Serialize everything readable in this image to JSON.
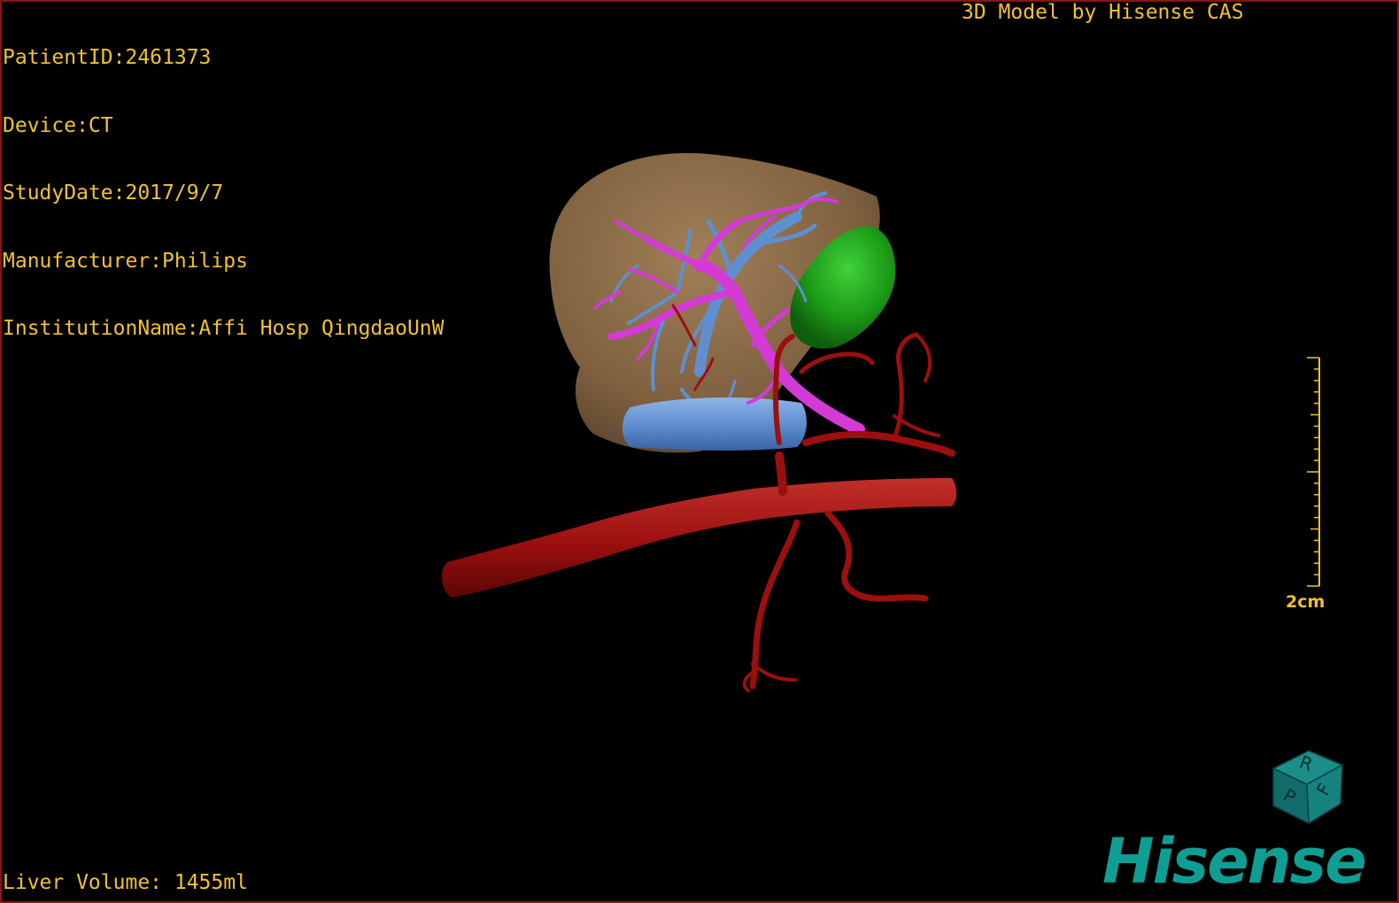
{
  "patient_info": {
    "patient_id": "PatientID:2461373",
    "device": "Device:CT",
    "study_date": "StudyDate:2017/9/7",
    "manufacturer": "Manufacturer:Philips",
    "institution": "InstitutionName:Affi Hosp QingdaoUnW"
  },
  "credit": "3D Model by Hisense CAS",
  "liver_volume": "Liver Volume: 1455ml",
  "scale_bar": {
    "label": "2cm"
  },
  "orientation_cube": {
    "faces": [
      "R",
      "F",
      "P"
    ]
  },
  "brand": "Hisense",
  "colors": {
    "overlay_text": "#f1c232",
    "frame": "#8a1414",
    "liver": "#8a6a45",
    "portal_vein": "#d43ad6",
    "hepatic_vein": "#5f8fd0",
    "artery": "#9c0f0f",
    "gallbladder": "#1f9a18",
    "brand": "#0f9e93"
  }
}
